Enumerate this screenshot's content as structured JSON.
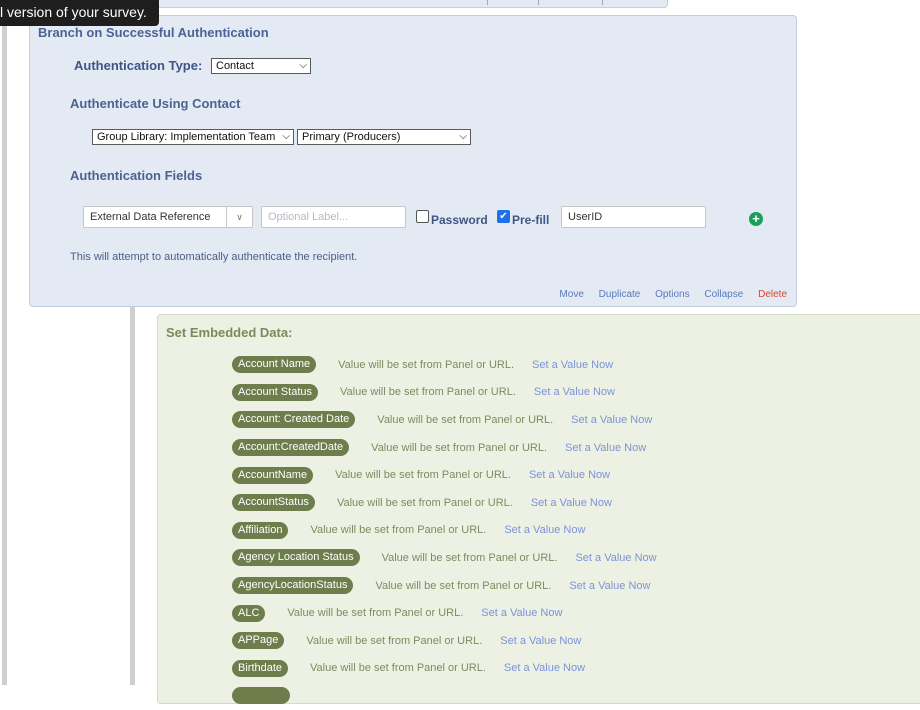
{
  "tooltip": {
    "text": "l version of your survey."
  },
  "auth_block": {
    "title": "Branch on Successful Authentication",
    "auth_type_label": "Authentication Type:",
    "auth_type_value": "Contact",
    "using_contact_heading": "Authenticate Using Contact",
    "library_select": "Group Library: Implementation Team",
    "list_select": "Primary (Producers)",
    "fields_heading": "Authentication Fields",
    "field": {
      "type": "External Data Reference",
      "label_placeholder": "Optional Label...",
      "password_label": "Password",
      "password_checked": false,
      "prefill_label": "Pre-fill",
      "prefill_checked": true,
      "value": "UserID",
      "add_icon": "plus-circle-icon"
    },
    "note": "This will attempt to automatically authenticate the recipient.",
    "actions": {
      "move": "Move",
      "duplicate": "Duplicate",
      "options": "Options",
      "collapse": "Collapse",
      "delete": "Delete"
    },
    "colors": {
      "delete": "#d9452b",
      "link": "#5a7ab8",
      "add": "#16a058"
    }
  },
  "embedded_data": {
    "title": "Set Embedded Data:",
    "rows": [
      {
        "name": "Account Name",
        "desc": "Value will be set from Panel or URL.",
        "link": "Set a Value Now"
      },
      {
        "name": "Account Status",
        "desc": "Value will be set from Panel or URL.",
        "link": "Set a Value Now"
      },
      {
        "name": "Account: Created Date",
        "desc": "Value will be set from Panel or URL.",
        "link": "Set a Value Now"
      },
      {
        "name": "Account:CreatedDate",
        "desc": "Value will be set from Panel or URL.",
        "link": "Set a Value Now"
      },
      {
        "name": "AccountName",
        "desc": "Value will be set from Panel or URL.",
        "link": "Set a Value Now"
      },
      {
        "name": "AccountStatus",
        "desc": "Value will be set from Panel or URL.",
        "link": "Set a Value Now"
      },
      {
        "name": "Affiliation",
        "desc": "Value will be set from Panel or URL.",
        "link": "Set a Value Now"
      },
      {
        "name": "Agency Location Status",
        "desc": "Value will be set from Panel or URL.",
        "link": "Set a Value Now"
      },
      {
        "name": "AgencyLocationStatus",
        "desc": "Value will be set from Panel or URL.",
        "link": "Set a Value Now"
      },
      {
        "name": "ALC",
        "desc": "Value will be set from Panel or URL.",
        "link": "Set a Value Now"
      },
      {
        "name": "APPage",
        "desc": "Value will be set from Panel or URL.",
        "link": "Set a Value Now"
      },
      {
        "name": "Birthdate",
        "desc": "Value will be set from Panel or URL.",
        "link": "Set a Value Now"
      },
      {
        "name": "",
        "desc": "",
        "link": ""
      }
    ],
    "colors": {
      "pill": "#6e7d4c",
      "link": "#7c93d8",
      "title": "#7a8a5a"
    }
  }
}
